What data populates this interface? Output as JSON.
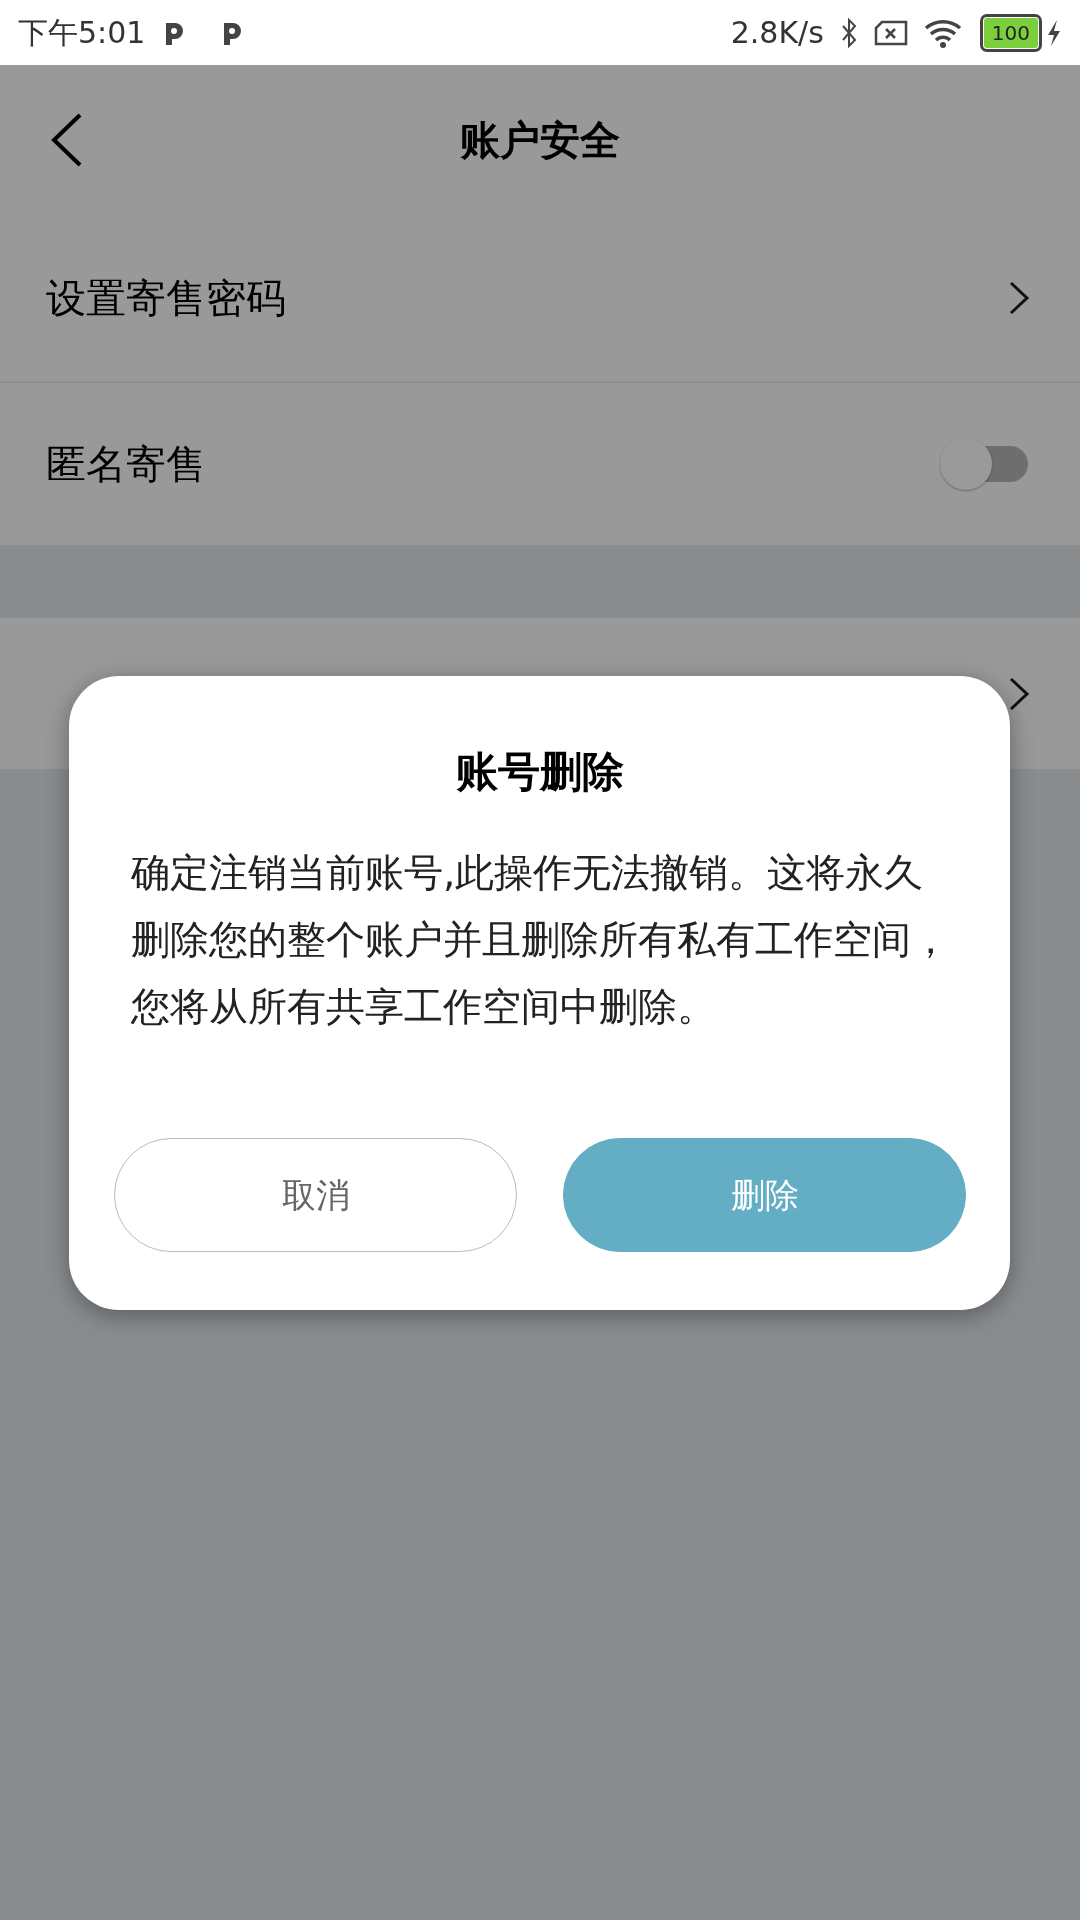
{
  "status_bar": {
    "time": "下午5:01",
    "network_speed": "2.8K/s",
    "battery": "100"
  },
  "header": {
    "title": "账户安全"
  },
  "settings": [
    {
      "kind": "link",
      "label": "设置寄售密码"
    },
    {
      "kind": "toggle",
      "label": "匿名寄售",
      "on": false
    }
  ],
  "account_section": [
    {
      "kind": "link"
    }
  ],
  "dialog": {
    "title": "账号删除",
    "message": "确定注销当前账号,此操作无法撤销。这将永久删除您的整个账户并且删除所有私有工作空间，您将从所有共享工作空间中删除。",
    "buttons": [
      {
        "kind": "secondary",
        "label": "取消"
      },
      {
        "kind": "primary",
        "label": "删除"
      }
    ]
  }
}
